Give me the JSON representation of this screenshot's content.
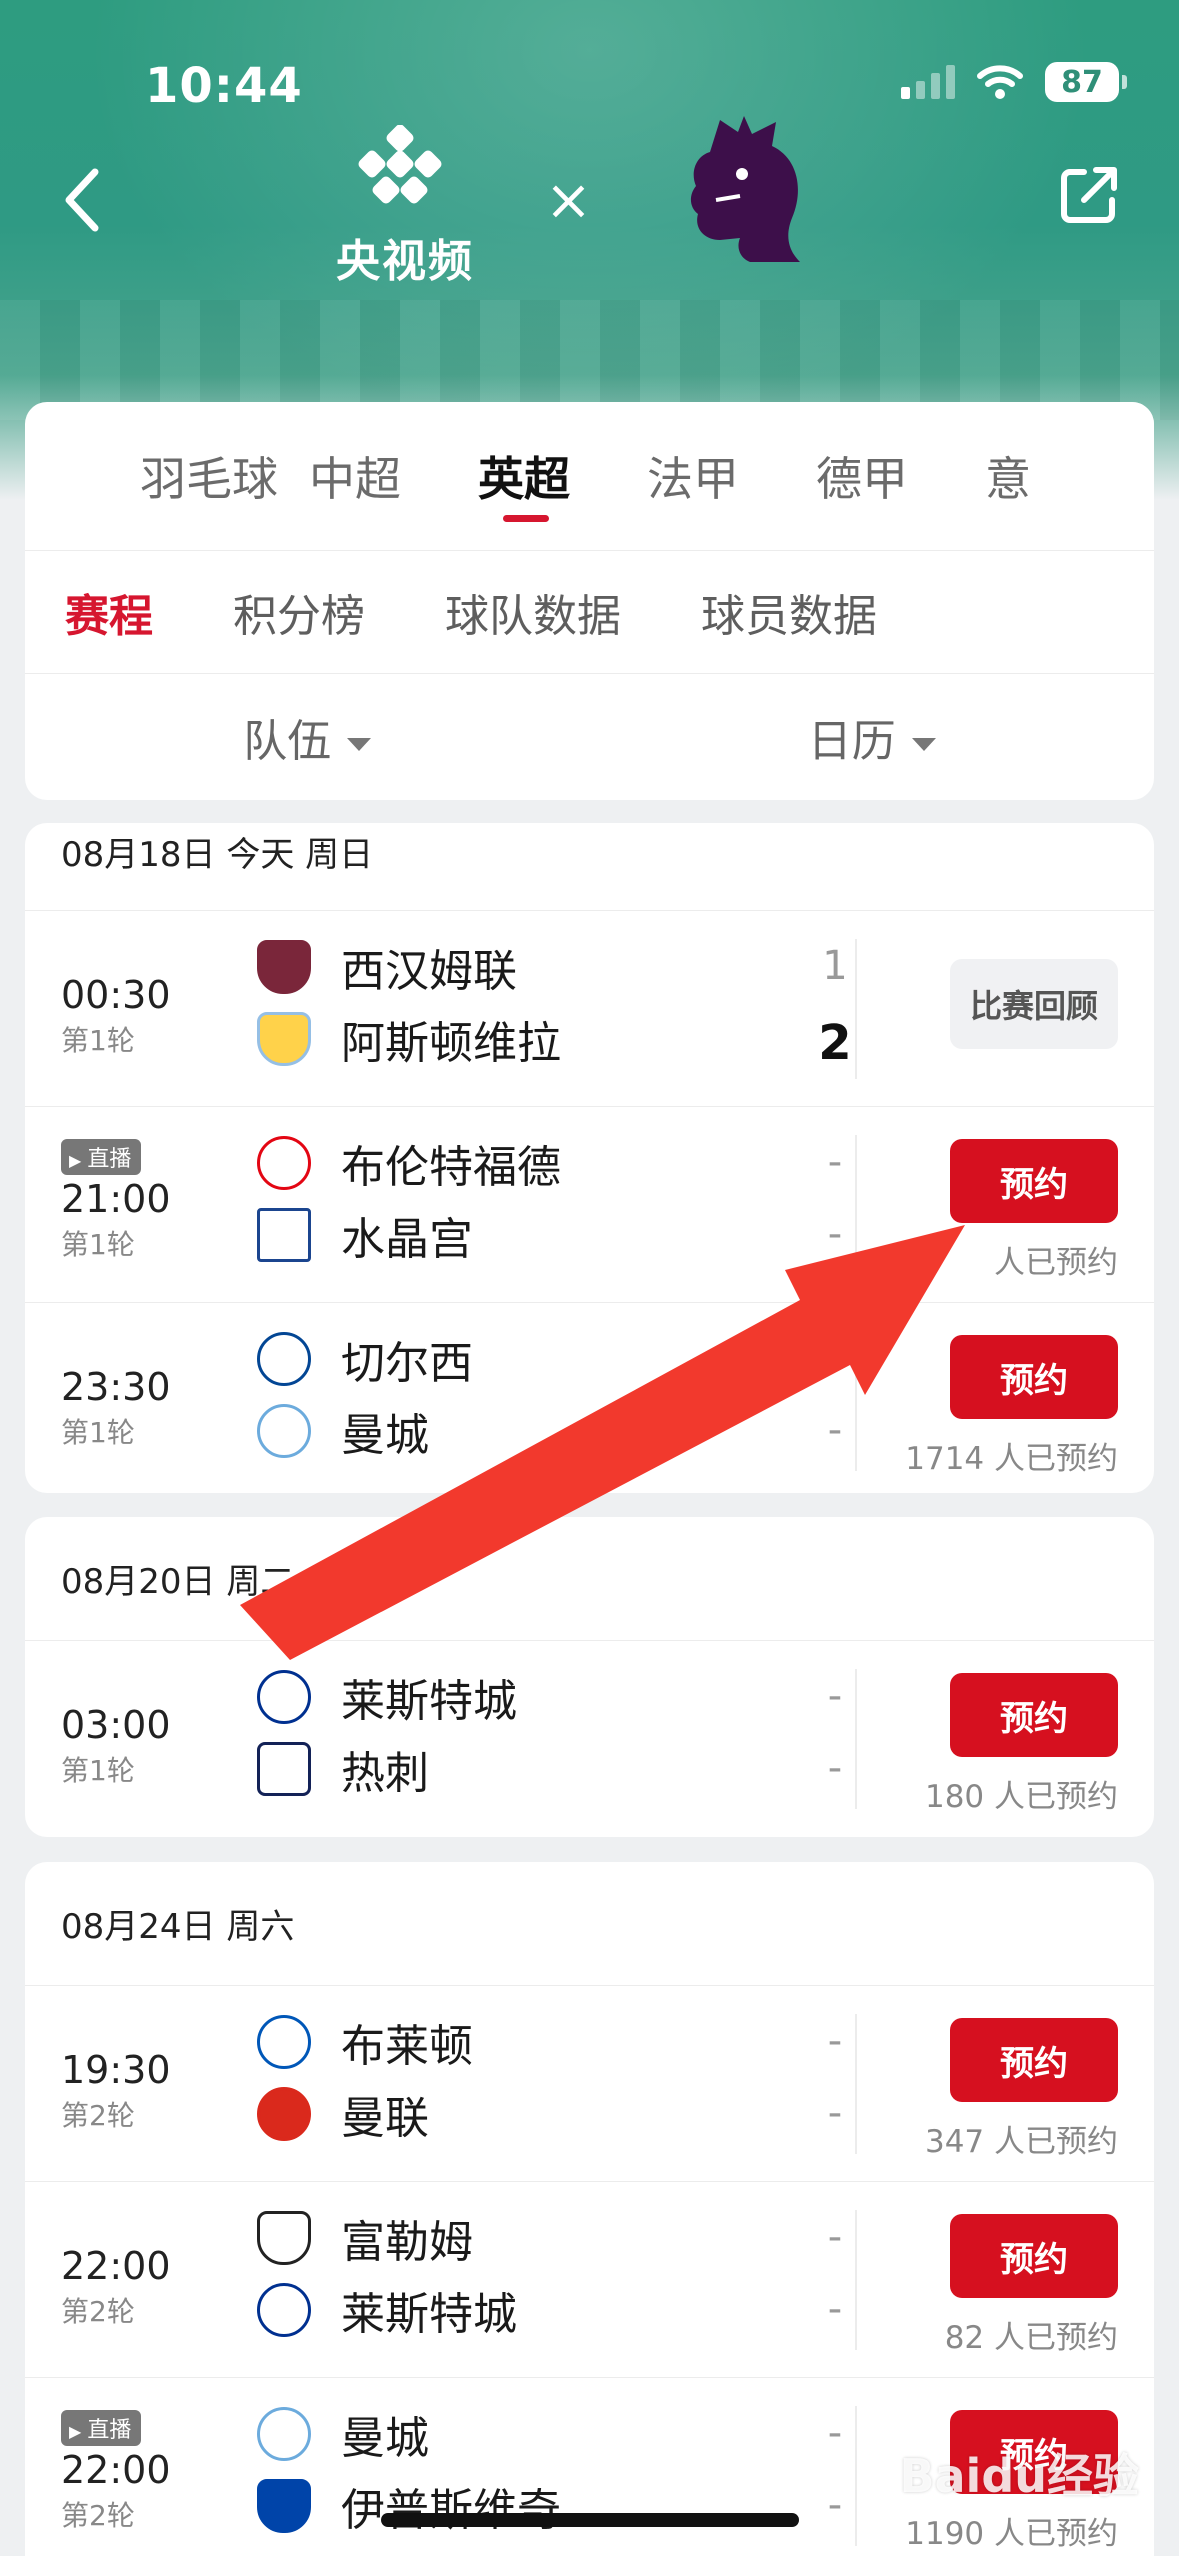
{
  "status_bar": {
    "time": "10:44",
    "battery": "87"
  },
  "header": {
    "brand_text": "央视频",
    "times_symbol": "×"
  },
  "league_tabs": [
    "羽毛球",
    "中超",
    "英超",
    "法甲",
    "德甲",
    "意"
  ],
  "sub_tabs": [
    "赛程",
    "积分榜",
    "球队数据",
    "球员数据"
  ],
  "filters": {
    "team": "队伍",
    "calendar": "日历"
  },
  "days": [
    {
      "header": "08月18日 今天 周日",
      "matches": [
        {
          "time": "00:30",
          "round": "第1轮",
          "live": "",
          "home": "西汉姆联",
          "away": "阿斯顿维拉",
          "score_home": "1",
          "score_away": "2",
          "action": "比赛回顾",
          "count": ""
        },
        {
          "time": "21:00",
          "round": "第1轮",
          "live": "直播",
          "home": "布伦特福德",
          "away": "水晶宫",
          "score_home": "-",
          "score_away": "-",
          "action": "预约",
          "count": "人已预约"
        },
        {
          "time": "23:30",
          "round": "第1轮",
          "live": "",
          "home": "切尔西",
          "away": "曼城",
          "score_home": "-",
          "score_away": "-",
          "action": "预约",
          "count": "1714 人已预约"
        }
      ]
    },
    {
      "header": "08月20日 周二",
      "matches": [
        {
          "time": "03:00",
          "round": "第1轮",
          "live": "",
          "home": "莱斯特城",
          "away": "热刺",
          "score_home": "-",
          "score_away": "-",
          "action": "预约",
          "count": "180 人已预约"
        }
      ]
    },
    {
      "header": "08月24日 周六",
      "matches": [
        {
          "time": "19:30",
          "round": "第2轮",
          "live": "",
          "home": "布莱顿",
          "away": "曼联",
          "score_home": "-",
          "score_away": "-",
          "action": "预约",
          "count": "347 人已预约"
        },
        {
          "time": "22:00",
          "round": "第2轮",
          "live": "",
          "home": "富勒姆",
          "away": "莱斯特城",
          "score_home": "-",
          "score_away": "-",
          "action": "预约",
          "count": "82 人已预约"
        },
        {
          "time": "22:00",
          "round": "第2轮",
          "live": "直播",
          "home": "曼城",
          "away": "伊普斯维奇",
          "score_home": "-",
          "score_away": "-",
          "action": "预约",
          "count": "1190 人已预约"
        }
      ]
    }
  ],
  "crest_colors": {
    "西汉姆联": "#7a263a",
    "阿斯顿维拉": "#95bfe5",
    "布伦特福德": "#e30613",
    "水晶宫": "#1b458f",
    "切尔西": "#034694",
    "曼城": "#6cabdd",
    "莱斯特城": "#003090",
    "热刺": "#132257",
    "布莱顿": "#0057b8",
    "曼联": "#da291c",
    "富勒姆": "#222222",
    "伊普斯维奇": "#0044a9"
  },
  "accent_color": "#d6162f",
  "icons": [
    "back-chevron-icon",
    "share-icon",
    "cctv-logo-icon",
    "premier-league-logo-icon"
  ],
  "watermark": "Baidu经验"
}
